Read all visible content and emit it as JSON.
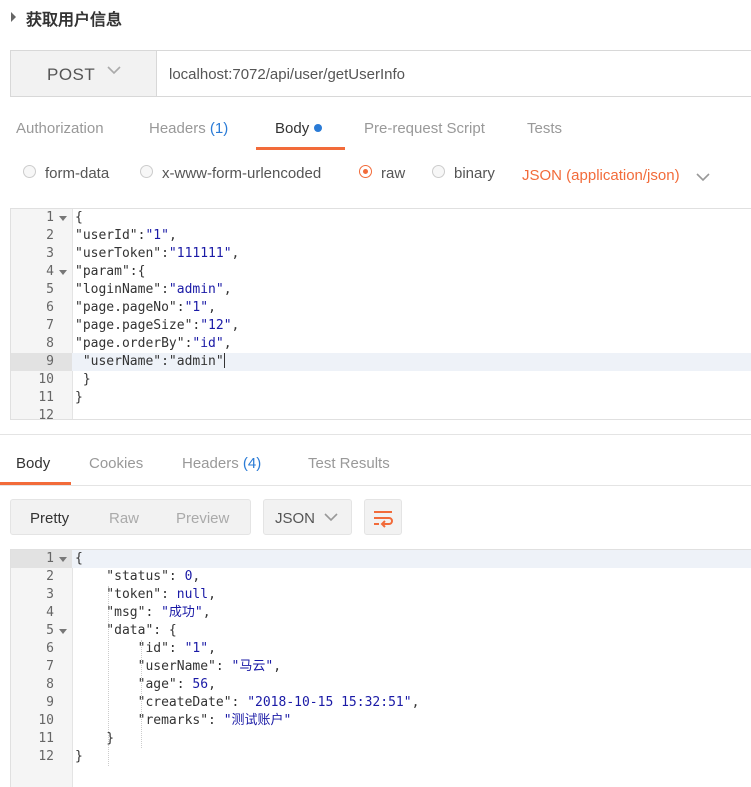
{
  "request": {
    "name": "获取用户信息",
    "method": "POST",
    "url": "localhost:7072/api/user/getUserInfo"
  },
  "request_tabs": [
    {
      "label": "Authorization",
      "count": ""
    },
    {
      "label": "Headers",
      "count": "(1)"
    },
    {
      "label": "Body",
      "count": ""
    },
    {
      "label": "Pre-request Script",
      "count": ""
    },
    {
      "label": "Tests",
      "count": ""
    }
  ],
  "body_types": {
    "form_data": "form-data",
    "urlencoded": "x-www-form-urlencoded",
    "raw": "raw",
    "binary": "binary",
    "selected": "raw",
    "content_type": "JSON (application/json)"
  },
  "request_body": {
    "line_numbers": [
      "1",
      "2",
      "3",
      "4",
      "5",
      "6",
      "7",
      "8",
      "9",
      "10",
      "11",
      "12"
    ],
    "lines": [
      "{",
      "\"userId\":\"1\",",
      "\"userToken\":\"111111\",",
      "\"param\":{",
      "\"loginName\":\"admin\",",
      "\"page.pageNo\":\"1\",",
      "\"page.pageSize\":\"12\",",
      "\"page.orderBy\":\"id\",",
      " \"userName\":\"admin\"",
      " }",
      "}",
      ""
    ]
  },
  "response_tabs": [
    {
      "label": "Body",
      "count": ""
    },
    {
      "label": "Cookies",
      "count": ""
    },
    {
      "label": "Headers",
      "count": "(4)"
    },
    {
      "label": "Test Results",
      "count": ""
    }
  ],
  "response_toolbar": {
    "views": [
      "Pretty",
      "Raw",
      "Preview"
    ],
    "format": "JSON"
  },
  "response_body": {
    "line_numbers": [
      "1",
      "2",
      "3",
      "4",
      "5",
      "6",
      "7",
      "8",
      "9",
      "10",
      "11",
      "12"
    ],
    "lines": [
      "{",
      "    \"status\": 0,",
      "    \"token\": null,",
      "    \"msg\": \"成功\",",
      "    \"data\": {",
      "        \"id\": \"1\",",
      "        \"userName\": \"马云\",",
      "        \"age\": 56,",
      "        \"createDate\": \"2018-10-15 15:32:51\",",
      "        \"remarks\": \"测试账户\"",
      "    }",
      "}"
    ]
  },
  "colors": {
    "accent": "#f26b3a",
    "count_blue": "#2a7bd6",
    "json_value": "#1a1aa6"
  }
}
